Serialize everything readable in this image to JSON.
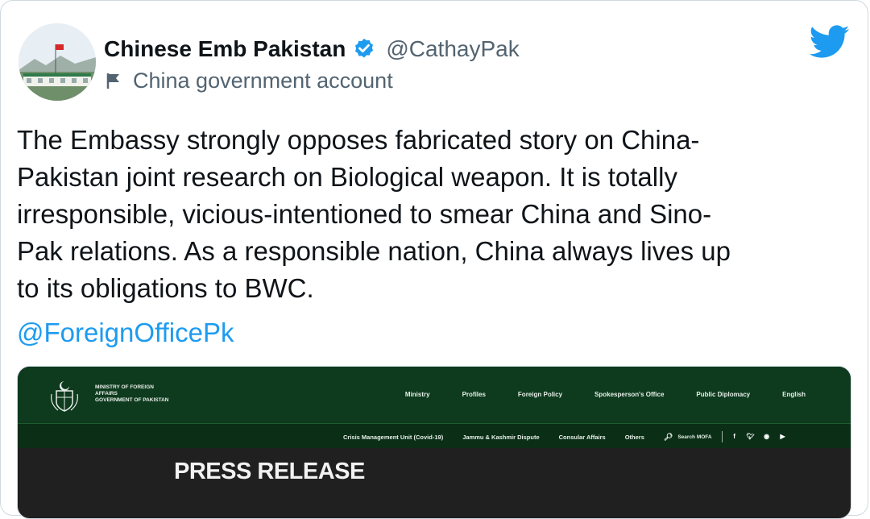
{
  "author": {
    "display_name": "Chinese Emb Pakistan",
    "handle": "@CathayPak",
    "label": "China government account"
  },
  "tweet": {
    "text": "The Embassy strongly opposes fabricated story on China-\nPakistan joint research on Biological weapon. It is totally\nirresponsible, vicious-intentioned to smear China and Sino-\nPak relations. As a responsible nation, China always lives up\nto its obligations to BWC.",
    "mention": "@ForeignOfficePk"
  },
  "embed": {
    "ministry_lines": [
      "MINISTRY OF FOREIGN",
      "AFFAIRS",
      "GOVERNMENT OF PAKISTAN"
    ],
    "main_nav": [
      "Ministry",
      "Profiles",
      "Foreign Policy",
      "Spokesperson's Office",
      "Public Diplomacy",
      "English"
    ],
    "sub_nav": [
      "Crisis Management Unit (Covid-19)",
      "Jammu & Kashmir Dispute",
      "Consular Affairs",
      "Others"
    ],
    "search_label": "Search MOFA",
    "social_icons": [
      "facebook-icon",
      "twitter-icon",
      "instagram-icon",
      "youtube-icon"
    ],
    "headline": "PRESS RELEASE"
  },
  "colors": {
    "link": "#1d9bf0",
    "twitter_blue": "#1d9bf0",
    "header_green": "#0e3a1e"
  }
}
